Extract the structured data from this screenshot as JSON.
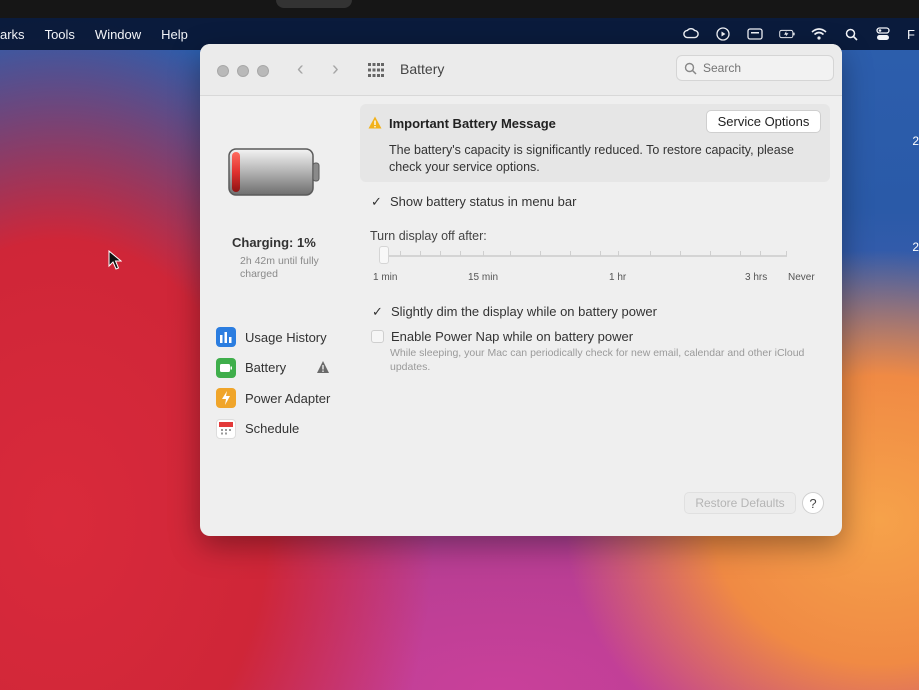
{
  "menubar": {
    "items": [
      "arks",
      "Tools",
      "Window",
      "Help"
    ],
    "status_trailing": "F"
  },
  "window": {
    "title": "Battery",
    "search_placeholder": "Search"
  },
  "battery_status": {
    "charging_label": "Charging: 1%",
    "time_remaining": "2h 42m until fully charged",
    "level_fraction": 0.01
  },
  "sidebar": {
    "items": [
      {
        "label": "Usage History",
        "icon": "bar-chart-icon",
        "color": "#2b7de0"
      },
      {
        "label": "Battery",
        "icon": "battery-icon",
        "color": "#3fae4b"
      },
      {
        "label": "Power Adapter",
        "icon": "bolt-icon",
        "color": "#f0a52a"
      },
      {
        "label": "Schedule",
        "icon": "calendar-icon",
        "color": "#e33a3a"
      }
    ]
  },
  "message": {
    "title": "Important Battery Message",
    "service_button": "Service Options",
    "body": "The battery's capacity is significantly reduced. To restore capacity, please check your service options."
  },
  "settings": {
    "show_status_label": "Show battery status in menu bar",
    "show_status_checked": true,
    "turn_off_label": "Turn display off after:",
    "slider_labels": [
      "1 min",
      "15 min",
      "1 hr",
      "3 hrs",
      "Never"
    ],
    "slider_value": "1 min",
    "dim_label": "Slightly dim the display while on battery power",
    "dim_checked": true,
    "power_nap_label": "Enable Power Nap while on battery power",
    "power_nap_checked": false,
    "power_nap_desc": "While sleeping, your Mac can periodically check for new email, calendar and other iCloud updates."
  },
  "footer": {
    "restore_button": "Restore Defaults",
    "help_button": "?"
  },
  "edge_numbers": [
    "2",
    "2"
  ],
  "colors": {
    "menubar": "#08163a",
    "window_bg": "#efefef",
    "warning": "#f2b21c",
    "battery_red": "#e0312f"
  }
}
